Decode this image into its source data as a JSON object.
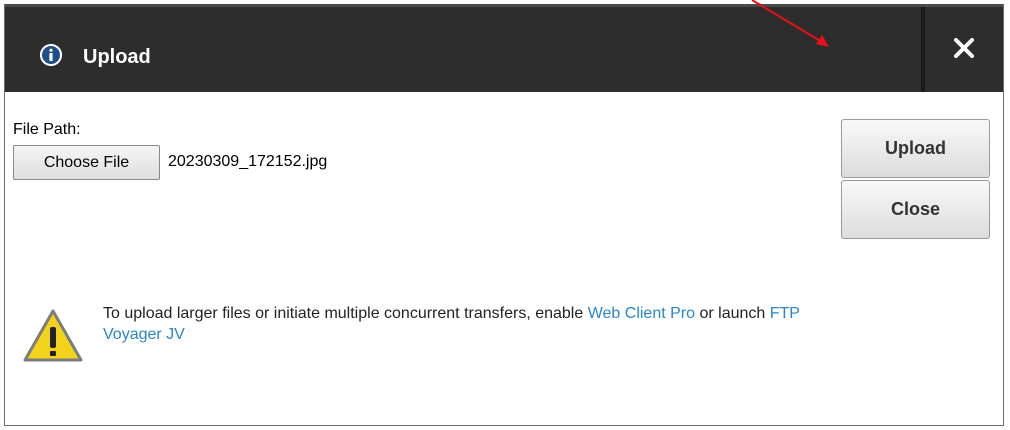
{
  "dialog": {
    "title": "Upload",
    "title_icon": "info-icon",
    "close_icon": "close-icon"
  },
  "form": {
    "file_path_label": "File Path:",
    "choose_file_label": "Choose File",
    "selected_file": "20230309_172152.jpg"
  },
  "actions": {
    "upload_label": "Upload",
    "close_label": "Close"
  },
  "notice": {
    "icon": "warning-icon",
    "text_before": "To upload larger files or initiate multiple concurrent transfers, enable ",
    "link1": "Web Client Pro",
    "text_middle": " or launch ",
    "link2": "FTP Voyager JV"
  },
  "colors": {
    "titlebar": "#2d2d2d",
    "link": "#2a86cc",
    "annotation_arrow": "#e8101a"
  }
}
